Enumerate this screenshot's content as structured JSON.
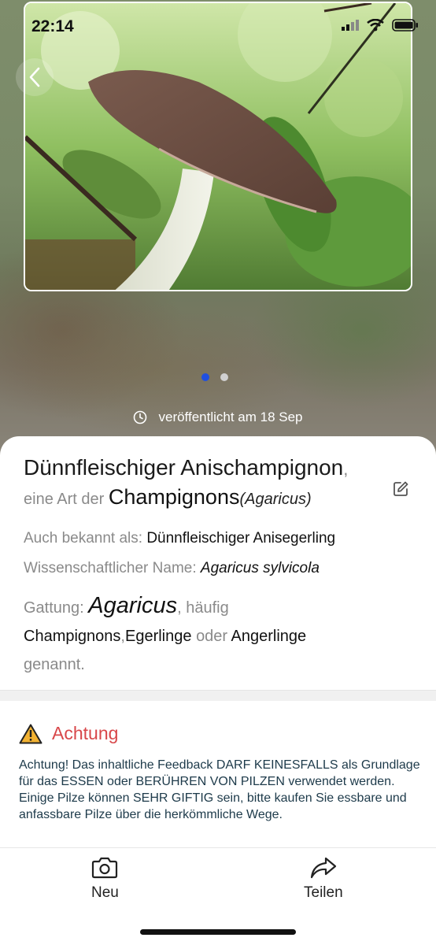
{
  "status_bar": {
    "time": "22:14"
  },
  "hero": {
    "carousel": {
      "page_count": 2,
      "active_index": 0
    },
    "published_label": "veröffentlicht am 18 Sep"
  },
  "species": {
    "name": "Dünnfleischiger Anischampignon",
    "name_suffix": ",",
    "type_prefix": "eine Art der",
    "genus_common": "Champignons",
    "genus_scientific": "(Agaricus)",
    "also_known_label": "Auch bekannt als:",
    "also_known_value": "Dünnfleischiger Anisegerling",
    "scientific_label": "Wissenschaftlicher Name:",
    "scientific_value": "Agaricus sylvicola",
    "gattung_label": "Gattung:",
    "gattung_value": "Agaricus",
    "gattung_common_prefix": ", häufig",
    "common_names": [
      "Champignons",
      "Egerlinge",
      "Angerlinge"
    ],
    "sep_comma": ",",
    "sep_or": "oder",
    "gattung_suffix": "genannt."
  },
  "warning": {
    "title": "Achtung",
    "text": "Achtung! Das inhaltliche Feedback DARF KEINESFALLS als Grundlage für das ESSEN oder BERÜHREN VON PILZEN verwendet werden. Einige Pilze können SEHR GIFTIG sein, bitte kaufen Sie essbare und anfassbare Pilze über die herkömmliche Wege."
  },
  "tabbar": {
    "new_label": "Neu",
    "share_label": "Teilen"
  },
  "icons": {
    "back": "chevron-left-icon",
    "clock": "clock-icon",
    "edit": "edit-icon",
    "warning": "warning-triangle-icon",
    "camera": "camera-icon",
    "share": "share-arrow-icon"
  },
  "colors": {
    "dot_active": "#1f4fe0",
    "dot_inactive": "#d0d0d0",
    "warning_title": "#d8474a",
    "warning_icon": "#f2b233"
  }
}
